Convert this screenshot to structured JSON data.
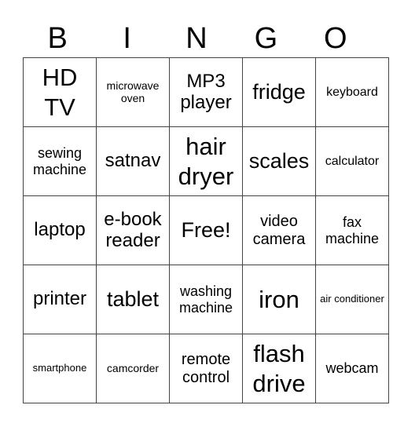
{
  "header": [
    "B",
    "I",
    "N",
    "G",
    "O"
  ],
  "grid": [
    [
      "HD TV",
      "microwave oven",
      "MP3 player",
      "fridge",
      "keyboard"
    ],
    [
      "sewing machine",
      "satnav",
      "hair dryer",
      "scales",
      "calculator"
    ],
    [
      "laptop",
      "e-book reader",
      "Free!",
      "video camera",
      "fax machine"
    ],
    [
      "printer",
      "tablet",
      "washing machine",
      "iron",
      "air conditioner"
    ],
    [
      "smartphone",
      "camcorder",
      "remote control",
      "flash drive",
      "webcam"
    ]
  ]
}
